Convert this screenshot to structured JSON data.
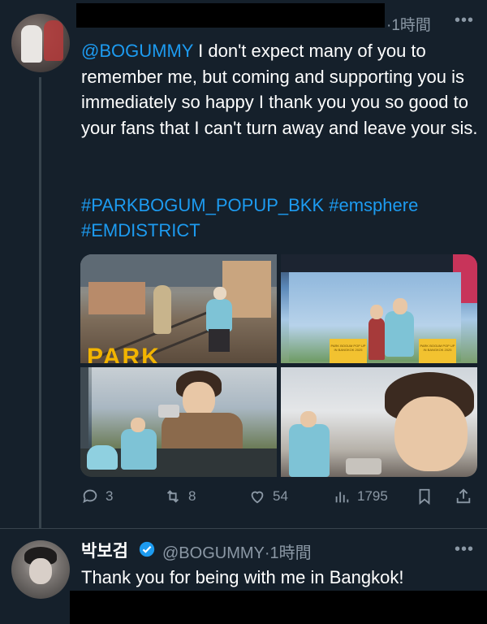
{
  "tweet": {
    "time": "·1時間",
    "mention": "@BOGUMMY",
    "text": " I don't expect many of you to remember me, but coming and supporting you is immediately so happy I thank you you so good to your fans that I can't turn away and leave your sis.",
    "hashtags_line1": "#PARKBOGUM_POPUP_BKK #emsphere",
    "hashtags_line2": "#EMDISTRICT",
    "media": {
      "image1_sign_text": "PARK",
      "image2_sign_text1": "PARK BOGUM POP UP IN BANGKOK 2025",
      "image2_sign_text2": "PARK BOGUM POP UP IN BANGKOK 2025"
    },
    "actions": {
      "replies": "3",
      "retweets": "8",
      "likes": "54",
      "views": "1795"
    }
  },
  "reply": {
    "name": "박보검",
    "handle": "@BOGUMMY",
    "time": "·1時間",
    "text": "Thank you for being with me in Bangkok!"
  },
  "colors": {
    "background": "#15202b",
    "accent": "#1d9bf0",
    "muted": "#8b98a5",
    "verified": "#1d9bf0"
  }
}
